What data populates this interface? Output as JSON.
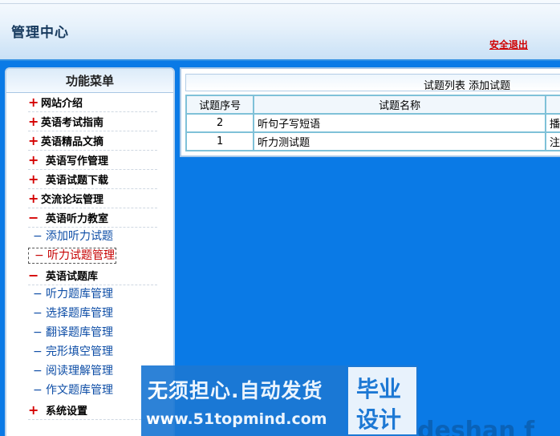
{
  "header": {
    "title": "管理中心",
    "logout": "安全退出"
  },
  "sidebar": {
    "title": "功能菜单",
    "items": [
      {
        "marker": "+",
        "label": "网站介绍",
        "type": "main"
      },
      {
        "marker": "+",
        "label": "英语考试指南",
        "type": "main"
      },
      {
        "marker": "+",
        "label": "英语精品文摘",
        "type": "main"
      },
      {
        "marker": "+",
        "label": "英语写作管理",
        "type": "main"
      },
      {
        "marker": "+",
        "label": "英语试题下载",
        "type": "main"
      },
      {
        "marker": "+",
        "label": "交流论坛管理",
        "type": "main"
      },
      {
        "marker": "−",
        "label": "英语听力教室",
        "type": "main"
      },
      {
        "marker": "−",
        "label": "添加听力试题",
        "type": "sub"
      },
      {
        "marker": "−",
        "label": "听力试题管理",
        "type": "sub-active"
      },
      {
        "marker": "−",
        "label": "英语试题库",
        "type": "main"
      },
      {
        "marker": "−",
        "label": "听力题库管理",
        "type": "sub"
      },
      {
        "marker": "−",
        "label": "选择题库管理",
        "type": "sub"
      },
      {
        "marker": "−",
        "label": "翻译题库管理",
        "type": "sub"
      },
      {
        "marker": "−",
        "label": "完形填空管理",
        "type": "sub"
      },
      {
        "marker": "−",
        "label": "阅读理解管理",
        "type": "sub"
      },
      {
        "marker": "−",
        "label": "作文题库管理",
        "type": "sub"
      },
      {
        "marker": "+",
        "label": "系统设置",
        "type": "main"
      }
    ]
  },
  "main": {
    "list_label": "试题列表",
    "add_label": "添加试题",
    "columns": [
      "试题序号",
      "试题名称",
      ""
    ],
    "rows": [
      {
        "id": "2",
        "name": "听句子写短语",
        "extra": "播"
      },
      {
        "id": "1",
        "name": "听力测试题",
        "extra": "注"
      }
    ]
  },
  "watermark": {
    "line1": "无须担心.自动发货",
    "line2": "www.51topmind.com",
    "badge1": "毕业",
    "badge2": "设计",
    "ghost": "deshan f"
  }
}
